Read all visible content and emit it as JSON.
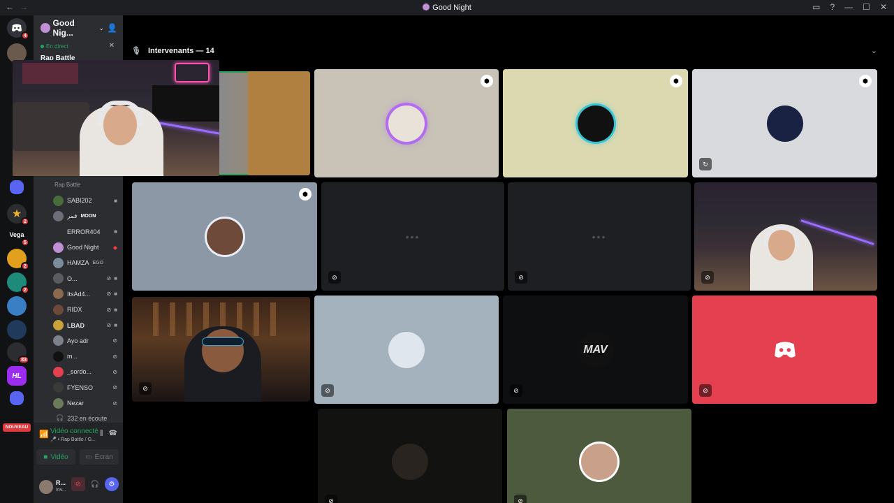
{
  "window": {
    "title": "Good Night",
    "nav_back": "←",
    "nav_forward": "→",
    "controls": [
      "▭",
      "?",
      "—",
      "☐",
      "✕"
    ]
  },
  "servers": [
    {
      "name": "discord-home",
      "label": "",
      "badge": "4"
    },
    {
      "name": "dm-user",
      "label": "",
      "badge": ""
    },
    {
      "name": "server-vega",
      "label": "Vega",
      "badge": "5"
    },
    {
      "name": "server-hl",
      "label": "HL",
      "badge": ""
    }
  ],
  "server_badges": [
    "2",
    "2",
    "2",
    "83"
  ],
  "nouveau_label": "NOUVEAU",
  "guild": {
    "name": "Good Nig...",
    "live_label": "En direct",
    "live_title": "Rap Battle",
    "channel_sub": "Rap Battle"
  },
  "members": [
    {
      "name": "SABI202",
      "tag": "",
      "icons": [
        "■"
      ]
    },
    {
      "name": "قمر",
      "tag": "MOON",
      "icons": []
    },
    {
      "name": "ERROR404",
      "tag": "",
      "icons": [
        "■"
      ]
    },
    {
      "name": "Good Night",
      "tag": "",
      "icons": [
        "◆"
      ]
    },
    {
      "name": "HAMZA",
      "tag": "EGO",
      "icons": []
    },
    {
      "name": "O...",
      "tag": "",
      "icons": [
        "⊘",
        "■"
      ]
    },
    {
      "name": "ItsAd4...",
      "tag": "",
      "icons": [
        "⊘",
        "■"
      ]
    },
    {
      "name": "RIDX",
      "tag": "",
      "icons": [
        "⊘",
        "■"
      ]
    },
    {
      "name": "LBAD",
      "tag": "",
      "icons": [
        "⊘",
        "■"
      ]
    },
    {
      "name": "Ayo adr",
      "tag": "",
      "icons": [
        "⊘"
      ]
    },
    {
      "name": "m...",
      "tag": "",
      "icons": [
        "⊘"
      ]
    },
    {
      "name": "_sordo...",
      "tag": "",
      "icons": [
        "⊘"
      ]
    },
    {
      "name": "FYENSO",
      "tag": "",
      "icons": [
        "⊘"
      ]
    },
    {
      "name": "Nezar",
      "tag": "",
      "icons": [
        "⊘"
      ]
    }
  ],
  "listening": "232 en écoute",
  "voice_panel": {
    "status": "Vidéo connecté",
    "channel": "🎤 • Rap Battle / G...",
    "video_label": "Vidéo",
    "screen_label": "Écran"
  },
  "user_panel": {
    "name": "R...",
    "status": "Inv..."
  },
  "stage": {
    "header": "Intervenants — 14"
  },
  "tiles": [
    {
      "name": "tile-grey-avatar",
      "bg": "#c8c3b6",
      "moderator": true,
      "muted": false
    },
    {
      "name": "tile-yellow-avatar",
      "bg": "#dcd9b0",
      "moderator": true,
      "muted": false
    },
    {
      "name": "tile-goodnight-logo",
      "bg": "#d8dadd",
      "moderator": true,
      "muted": false
    },
    {
      "name": "tile-blue-avatar",
      "bg": "#8d98a6",
      "moderator": true,
      "muted": false
    },
    {
      "name": "tile-no-video-1",
      "bg": "#1e1f22",
      "moderator": false,
      "muted": true
    },
    {
      "name": "tile-no-video-2",
      "bg": "#1e1f22",
      "moderator": false,
      "muted": true
    },
    {
      "name": "tile-webcam-right",
      "bg": "#2d2a33",
      "moderator": false,
      "muted": true
    },
    {
      "name": "tile-studio",
      "bg": "#3a2418",
      "moderator": false,
      "muted": true
    },
    {
      "name": "tile-steel-avatar",
      "bg": "#a4b2bd",
      "moderator": false,
      "muted": true
    },
    {
      "name": "tile-mav-logo",
      "bg": "#0d0f10",
      "moderator": false,
      "muted": true
    },
    {
      "name": "tile-discord-red",
      "bg": "#e5404f",
      "moderator": false,
      "muted": true
    },
    {
      "name": "tile-dark-avatar",
      "bg": "#121210",
      "moderator": false,
      "muted": true
    },
    {
      "name": "tile-olive-avatar",
      "bg": "#4d5a3d",
      "moderator": false,
      "muted": true
    }
  ],
  "mav_logo_text": "MAV",
  "icons": {
    "mic": "mic-icon",
    "chevron": "chevron-down-icon",
    "mod": "moderator-shield-icon",
    "mute": "mic-muted-icon",
    "discord": "discord-logo-icon"
  }
}
